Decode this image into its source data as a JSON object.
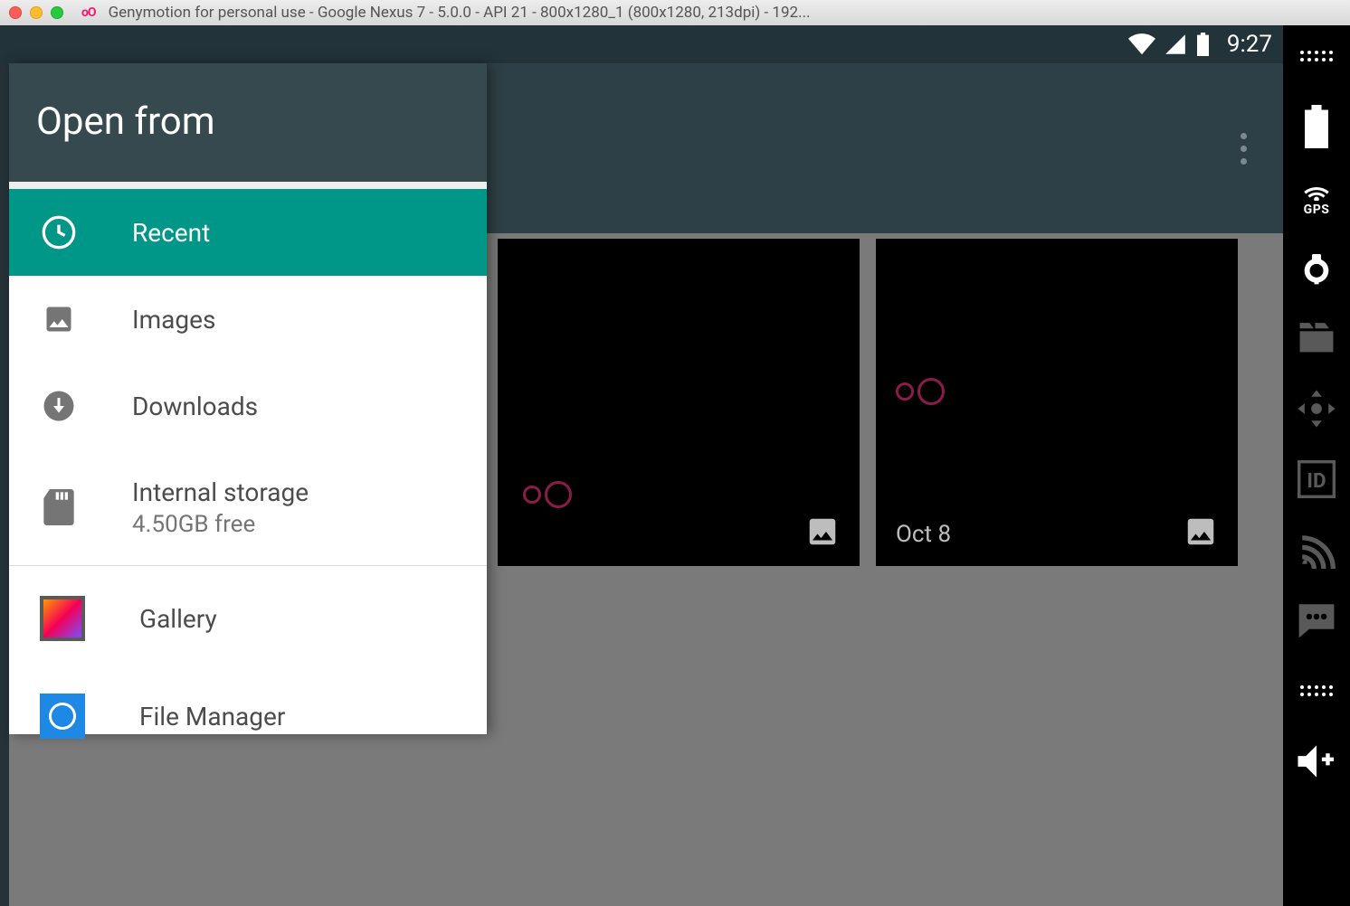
{
  "mac": {
    "title": "Genymotion for personal use - Google Nexus 7 - 5.0.0 - API 21 - 800x1280_1 (800x1280, 213dpi) - 192..."
  },
  "statusbar": {
    "time": "9:27"
  },
  "drawer": {
    "title": "Open from",
    "items": [
      {
        "label": "Recent"
      },
      {
        "label": "Images"
      },
      {
        "label": "Downloads"
      },
      {
        "label": "Internal storage",
        "sub": "4.50GB free"
      }
    ],
    "apps": [
      {
        "label": "Gallery"
      },
      {
        "label": "File Manager"
      }
    ]
  },
  "thumbs": [
    {
      "date": ""
    },
    {
      "date": "Oct 8"
    }
  ],
  "geny_sidebar": {
    "gps_label": "GPS"
  }
}
